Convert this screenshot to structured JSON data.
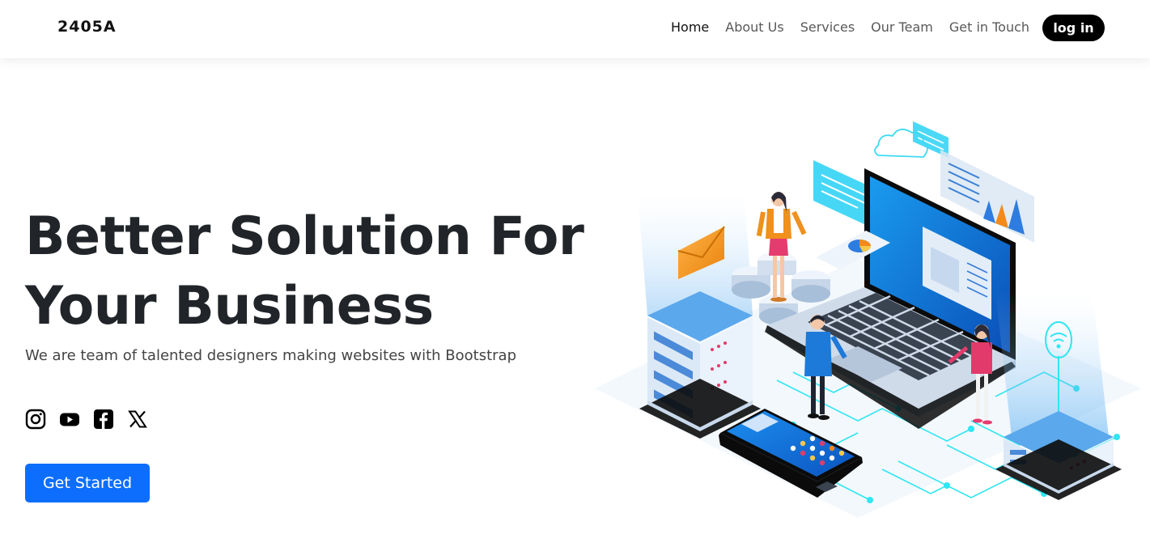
{
  "nav": {
    "brand": "2405A",
    "links": [
      "Home",
      "About Us",
      "Services",
      "Our Team",
      "Get in Touch"
    ],
    "login_label": "log in"
  },
  "hero": {
    "title_line1": "Better Solution For",
    "title_line2": "Your Business",
    "subtitle": "We are team of talented designers making websites with Bootstrap",
    "cta_label": "Get Started"
  },
  "socials": [
    "instagram-icon",
    "youtube-icon",
    "facebook-icon",
    "x-icon"
  ],
  "colors": {
    "primary": "#0d6efd",
    "login_bg": "#000000",
    "accent_cyan": "#27e3f5"
  }
}
